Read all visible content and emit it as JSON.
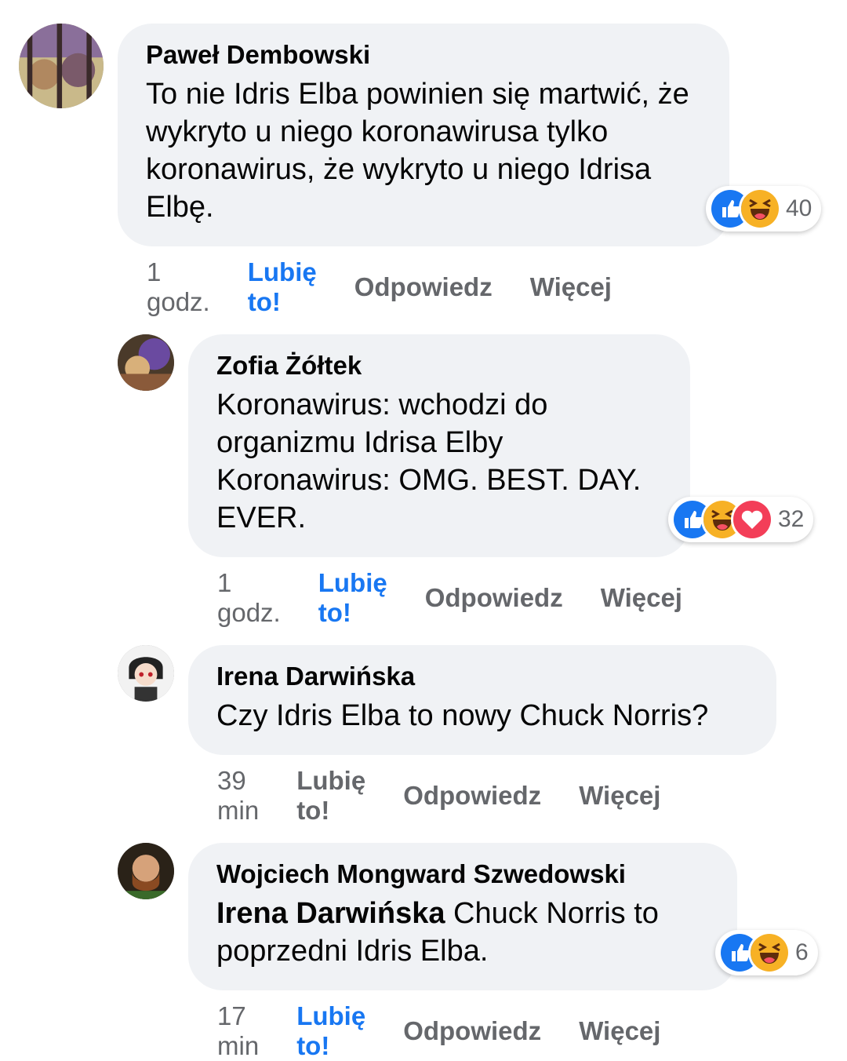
{
  "comments": [
    {
      "author": "Paweł Dembowski",
      "text": "To nie Idris Elba powinien się martwić, że wykryto u niego koronawirusa tylko koronawirus, że wykryto u niego Idrisa Elbę.",
      "time": "1 godz.",
      "like": "Lubię to!",
      "reply": "Odpowiedz",
      "more": "Więcej",
      "reactions": [
        "like-icon",
        "haha-icon"
      ],
      "reaction_count": "40"
    },
    {
      "author": "Zofia Żółtek",
      "text": "Koronawirus: wchodzi do organizmu Idrisa Elby Koronawirus: OMG. BEST. DAY. EVER.",
      "time": "1 godz.",
      "like": "Lubię to!",
      "reply": "Odpowiedz",
      "more": "Więcej",
      "reactions": [
        "like-icon",
        "haha-icon",
        "love-icon"
      ],
      "reaction_count": "32"
    },
    {
      "author": "Irena Darwińska",
      "text": "Czy Idris Elba to nowy Chuck Norris?",
      "time": "39 min",
      "like": "Lubię to!",
      "reply": "Odpowiedz",
      "more": "Więcej"
    },
    {
      "author": "Wojciech Mongward Szwedowski",
      "mention": "Irena Darwińska",
      "text": "Chuck Norris to poprzedni Idris Elba.",
      "time": "17 min",
      "like": "Lubię to!",
      "reply": "Odpowiedz",
      "more": "Więcej",
      "reactions": [
        "like-icon",
        "haha-icon"
      ],
      "reaction_count": "6"
    }
  ],
  "colors": {
    "bubble": "#f0f2f5",
    "liked": "#1877f2",
    "meta": "#65676b"
  }
}
